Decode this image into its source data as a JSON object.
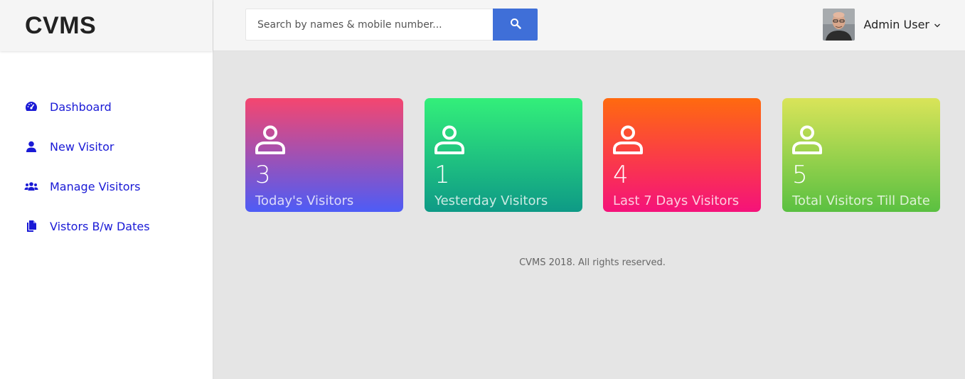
{
  "brand": {
    "title": "CVMS"
  },
  "sidebar": {
    "items": [
      {
        "label": "Dashboard",
        "icon": "dashboard-icon"
      },
      {
        "label": "New Visitor",
        "icon": "user-icon"
      },
      {
        "label": "Manage Visitors",
        "icon": "users-icon"
      },
      {
        "label": "Vistors B/w Dates",
        "icon": "file-icon"
      }
    ]
  },
  "header": {
    "search": {
      "placeholder": "Search by names & mobile number...",
      "value": ""
    },
    "user": {
      "name": "Admin User"
    }
  },
  "stats": [
    {
      "value": "3",
      "label": "Today's Visitors"
    },
    {
      "value": "1",
      "label": "Yesterday Visitors"
    },
    {
      "value": "4",
      "label": "Last 7 Days Visitors"
    },
    {
      "value": "5",
      "label": "Total Visitors Till Date"
    }
  ],
  "footer": {
    "text": "CVMS 2018. All rights reserved."
  },
  "colors": {
    "nav_link": "#1a1ad6",
    "search_button": "#3f6fd8"
  }
}
